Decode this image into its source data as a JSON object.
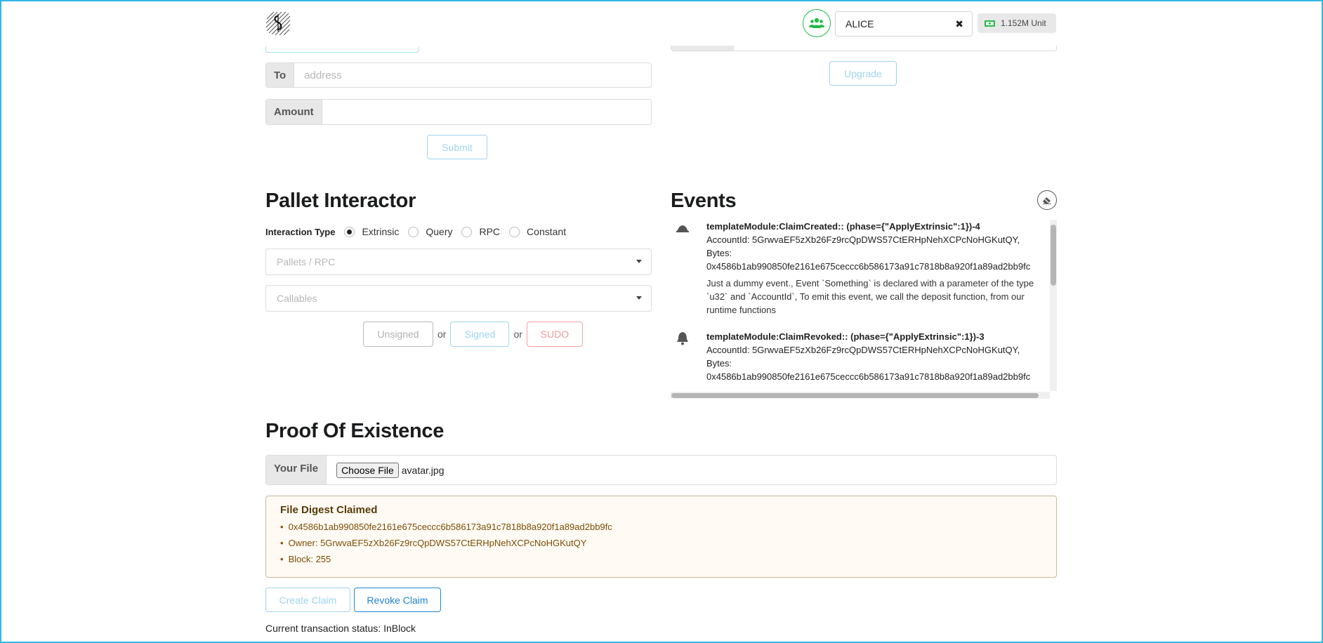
{
  "header": {
    "account_name": "ALICE",
    "clear_glyph": "✖",
    "balance": "1.152M Unit",
    "colors": {
      "users_icon": "#21ba45",
      "balance_icon": "#21ba45"
    }
  },
  "transfer": {
    "to_label": "To",
    "to_placeholder": "address",
    "amount_label": "Amount",
    "amount_value": "",
    "submit_label": "Submit"
  },
  "upgrade": {
    "button_label": "Upgrade"
  },
  "pallet_interactor": {
    "title": "Pallet Interactor",
    "interaction_type_label": "Interaction Type",
    "options": [
      {
        "label": "Extrinsic",
        "selected": true
      },
      {
        "label": "Query",
        "selected": false
      },
      {
        "label": "RPC",
        "selected": false
      },
      {
        "label": "Constant",
        "selected": false
      }
    ],
    "pallets_placeholder": "Pallets / RPC",
    "callables_placeholder": "Callables",
    "unsigned_label": "Unsigned",
    "signed_label": "Signed",
    "sudo_label": "SUDO",
    "or_text": "or"
  },
  "events": {
    "title": "Events",
    "items": [
      {
        "title": "templateModule:ClaimCreated:: (phase={\"ApplyExtrinsic\":1})-4",
        "account": "AccountId: 5GrwvaEF5zXb26Fz9rcQpDWS57CtERHpNehXCPcNoHGKutQY,",
        "bytes_label": "Bytes:",
        "bytes": "0x4586b1ab990850fe2161e675ceccc6b586173a91c7818b8a920f1a89ad2bb9fc",
        "description": "Just a dummy event., Event `Something` is declared with a parameter of the type `u32` and `AccountId`, To emit this event, we call the deposit function, from our runtime functions"
      },
      {
        "title": "templateModule:ClaimRevoked:: (phase={\"ApplyExtrinsic\":1})-3",
        "account": "AccountId: 5GrwvaEF5zXb26Fz9rcQpDWS57CtERHpNehXCPcNoHGKutQY,",
        "bytes_label": "Bytes:",
        "bytes": "0x4586b1ab990850fe2161e675ceccc6b586173a91c7818b8a920f1a89ad2bb9fc"
      }
    ]
  },
  "proof_of_existence": {
    "title": "Proof Of Existence",
    "file_label": "Your File",
    "choose_file_label": "Choose File",
    "file_name": "avatar.jpg",
    "claim_box": {
      "heading": "File Digest Claimed",
      "digest": "0x4586b1ab990850fe2161e675ceccc6b586173a91c7818b8a920f1a89ad2bb9fc",
      "owner": "Owner: 5GrwvaEF5zXb26Fz9rcQpDWS57CtERHpNehXCPcNoHGKutQY",
      "block": "Block: 255"
    },
    "create_claim_label": "Create Claim",
    "revoke_claim_label": "Revoke Claim",
    "status": "Current transaction status: InBlock"
  }
}
